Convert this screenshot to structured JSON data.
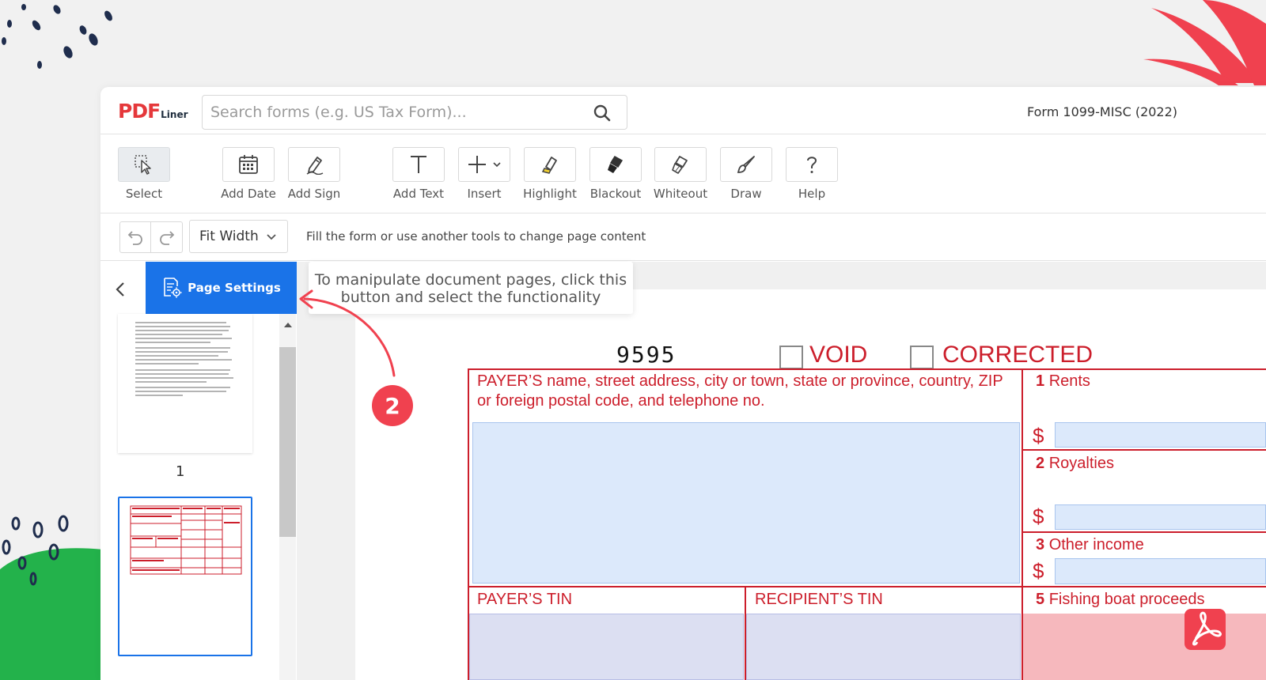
{
  "header": {
    "logo_main": "PDF",
    "logo_sub": "Liner",
    "search_placeholder": "Search forms (e.g. US Tax Form)...",
    "form_title": "Form 1099-MISC (2022)"
  },
  "toolbar": {
    "select": "Select",
    "add_date": "Add Date",
    "add_sign": "Add Sign",
    "add_text": "Add Text",
    "insert": "Insert",
    "highlight": "Highlight",
    "blackout": "Blackout",
    "whiteout": "Whiteout",
    "draw": "Draw",
    "help": "Help"
  },
  "subbar": {
    "zoom": "Fit Width",
    "hint": "Fill the form or use another tools to change page content"
  },
  "sidebar": {
    "page_settings": "Page Settings",
    "page_number": "1"
  },
  "tooltip": {
    "line1": "To manipulate document pages, click this",
    "line2": "button and select the functionality"
  },
  "step_marker": "2",
  "form": {
    "code": "9595",
    "void": "VOID",
    "corrected": "CORRECTED",
    "payer_line1": "PAYER’S name, street address, city or town, state or province, country, ZIP",
    "payer_line2": "or foreign postal code, and telephone no.",
    "box1_num": "1",
    "box1_label": "Rents",
    "box2_num": "2",
    "box2_label": "Royalties",
    "box3_num": "3",
    "box3_label": "Other income",
    "box5_num": "5",
    "box5_label": "Fishing boat proceeds",
    "payer_tin": "PAYER’S TIN",
    "recipient_tin": "RECIPIENT’S TIN",
    "dollar": "$"
  },
  "colors": {
    "accent": "#1a73e8",
    "brand_red": "#e5383b",
    "form_red": "#cc1e2b",
    "marker": "#f0414f"
  }
}
